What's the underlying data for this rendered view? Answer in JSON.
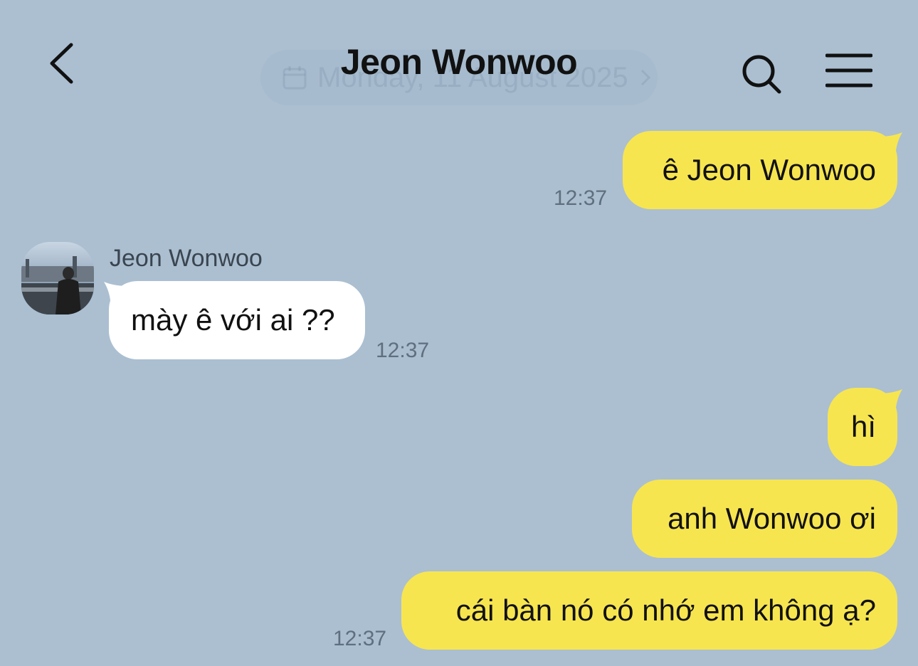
{
  "header": {
    "title": "Jeon Wonwoo",
    "date_pill": "Monday, 11 August 2025"
  },
  "icons": {
    "back": "chevron-left-icon",
    "search": "search-icon",
    "menu": "hamburger-menu-icon",
    "calendar": "calendar-icon"
  },
  "colors": {
    "background": "#abbfd1",
    "outgoing_bubble": "#f7e550",
    "incoming_bubble": "#ffffff"
  },
  "messages": [
    {
      "direction": "out",
      "text": "ê Jeon Wonwoo",
      "time": "12:37"
    },
    {
      "direction": "in",
      "sender": "Jeon Wonwoo",
      "text": "mày ê với ai ??",
      "time": "12:37"
    },
    {
      "direction": "out",
      "text": "hì"
    },
    {
      "direction": "out",
      "text": "anh Wonwoo ơi"
    },
    {
      "direction": "out",
      "text": "cái bàn nó có nhớ em không ạ?",
      "time": "12:37"
    }
  ]
}
